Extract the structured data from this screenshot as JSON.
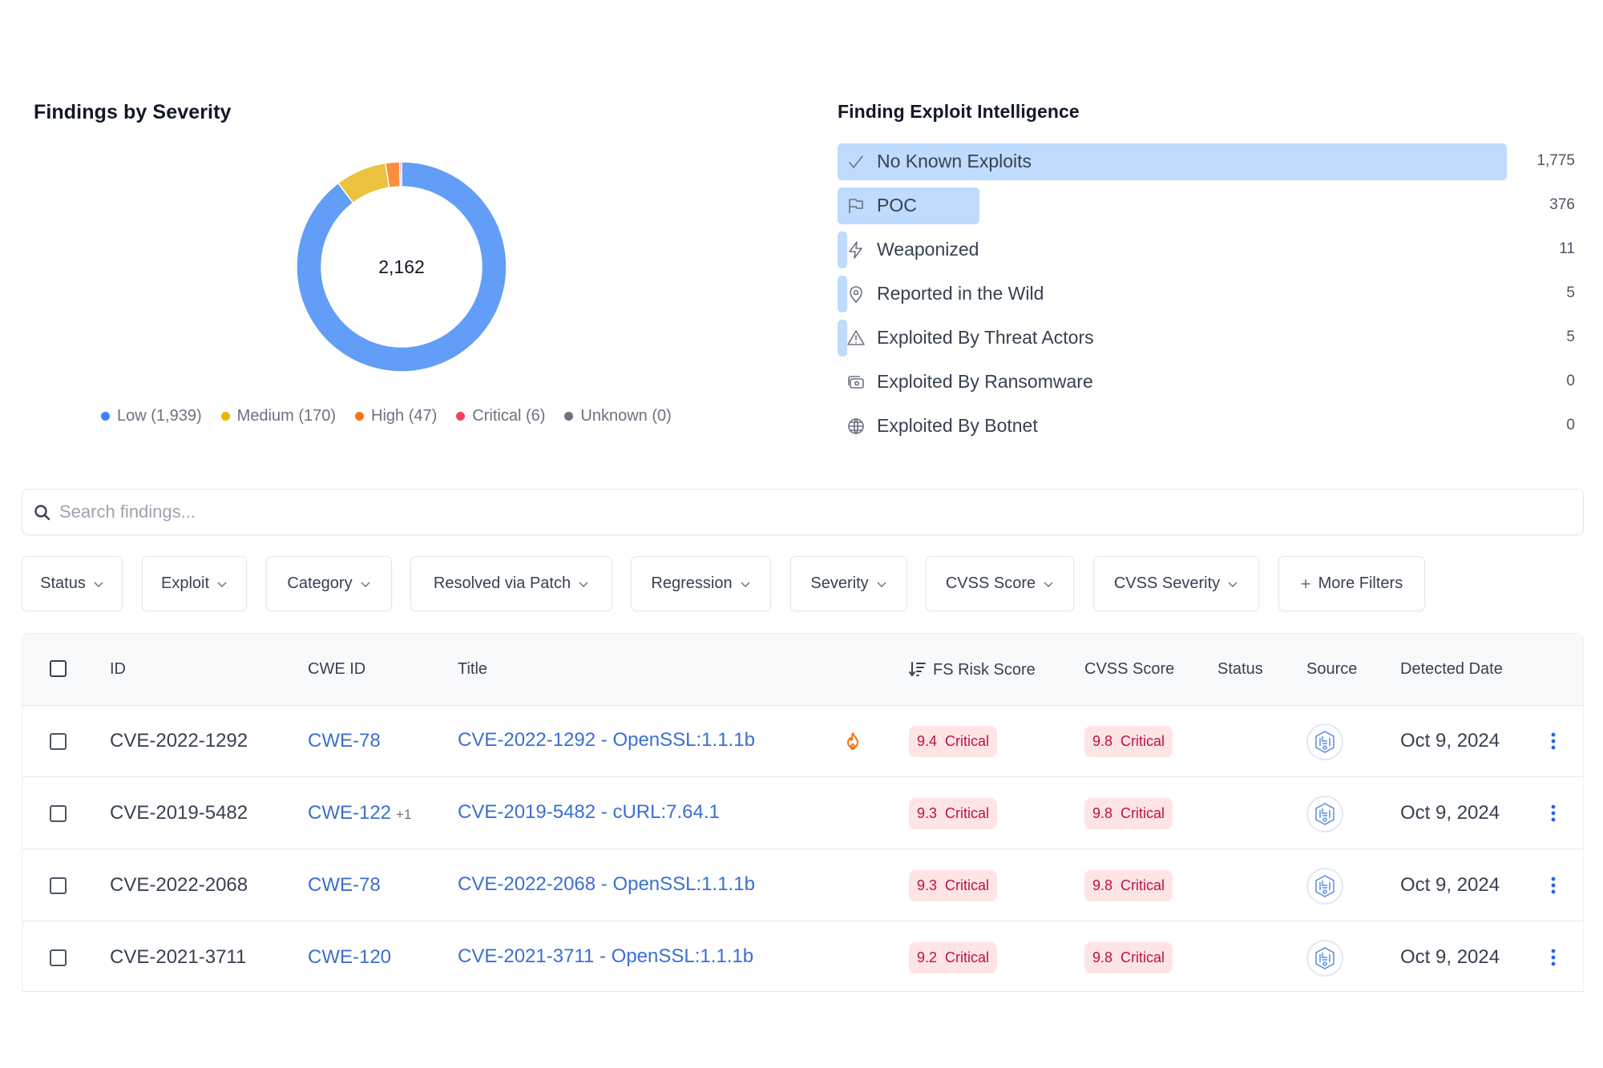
{
  "severity_panel": {
    "title": "Findings by Severity",
    "total": "2,162",
    "legend": [
      {
        "label": "Low (1,939)",
        "color": "#3b82f6"
      },
      {
        "label": "Medium (170)",
        "color": "#eab308"
      },
      {
        "label": "High (47)",
        "color": "#f97316"
      },
      {
        "label": "Critical (6)",
        "color": "#f43f5e"
      },
      {
        "label": "Unknown (0)",
        "color": "#6b7280"
      }
    ]
  },
  "chart_data": {
    "type": "pie",
    "title": "Findings by Severity",
    "center_label": "2,162",
    "categories": [
      "Low",
      "Medium",
      "High",
      "Critical",
      "Unknown"
    ],
    "values": [
      1939,
      170,
      47,
      6,
      0
    ],
    "colors": [
      "#629ef8",
      "#ecc23e",
      "#f98d40",
      "#f2576e",
      "#6b7280"
    ],
    "legend_position": "bottom"
  },
  "exploit_panel": {
    "title": "Finding Exploit Intelligence",
    "max": 1775,
    "items": [
      {
        "label": "No Known Exploits",
        "value": 1775,
        "display": "1,775",
        "icon": "check-icon"
      },
      {
        "label": "POC",
        "value": 376,
        "display": "376",
        "icon": "flag-icon"
      },
      {
        "label": "Weaponized",
        "value": 11,
        "display": "11",
        "icon": "lightning-icon"
      },
      {
        "label": "Reported in the Wild",
        "value": 5,
        "display": "5",
        "icon": "map-pin-icon"
      },
      {
        "label": "Exploited By Threat Actors",
        "value": 5,
        "display": "5",
        "icon": "warning-triangle-icon"
      },
      {
        "label": "Exploited By Ransomware",
        "value": 0,
        "display": "0",
        "icon": "ransomware-icon"
      },
      {
        "label": "Exploited By Botnet",
        "value": 0,
        "display": "0",
        "icon": "globe-icon"
      }
    ]
  },
  "search": {
    "placeholder": "Search findings...",
    "value": ""
  },
  "filters": [
    {
      "label": "Status",
      "dropdown": true
    },
    {
      "label": "Exploit",
      "dropdown": true
    },
    {
      "label": "Category",
      "dropdown": true
    },
    {
      "label": "Resolved via Patch",
      "dropdown": true
    },
    {
      "label": "Regression",
      "dropdown": true
    },
    {
      "label": "Severity",
      "dropdown": true
    },
    {
      "label": "CVSS Score",
      "dropdown": true
    },
    {
      "label": "CVSS Severity",
      "dropdown": true
    },
    {
      "label": "More Filters",
      "dropdown": false,
      "prefix": "+"
    }
  ],
  "table": {
    "columns": {
      "id": "ID",
      "cwe": "CWE ID",
      "title": "Title",
      "fs_risk": "FS Risk Score",
      "cvss": "CVSS Score",
      "status": "Status",
      "source": "Source",
      "date": "Detected Date"
    },
    "sort_column": "FS Risk Score",
    "rows": [
      {
        "id": "CVE-2022-1292",
        "cwe": "CWE-78",
        "cwe_extra": "",
        "title": "CVE-2022-1292 - OpenSSL:1.1.1b",
        "hot": true,
        "fs_score": "9.4",
        "fs_severity": "Critical",
        "cvss_score": "9.8",
        "cvss_severity": "Critical",
        "status": "",
        "source_icon": "scanner-logo-icon",
        "date": "Oct 9, 2024"
      },
      {
        "id": "CVE-2019-5482",
        "cwe": "CWE-122",
        "cwe_extra": "+1",
        "title": "CVE-2019-5482 - cURL:7.64.1",
        "hot": false,
        "fs_score": "9.3",
        "fs_severity": "Critical",
        "cvss_score": "9.8",
        "cvss_severity": "Critical",
        "status": "",
        "source_icon": "scanner-logo-icon",
        "date": "Oct 9, 2024"
      },
      {
        "id": "CVE-2022-2068",
        "cwe": "CWE-78",
        "cwe_extra": "",
        "title": "CVE-2022-2068 - OpenSSL:1.1.1b",
        "hot": false,
        "fs_score": "9.3",
        "fs_severity": "Critical",
        "cvss_score": "9.8",
        "cvss_severity": "Critical",
        "status": "",
        "source_icon": "scanner-logo-icon",
        "date": "Oct 9, 2024"
      },
      {
        "id": "CVE-2021-3711",
        "cwe": "CWE-120",
        "cwe_extra": "",
        "title": "CVE-2021-3711 - OpenSSL:1.1.1b",
        "hot": false,
        "fs_score": "9.2",
        "fs_severity": "Critical",
        "cvss_score": "9.8",
        "cvss_severity": "Critical",
        "status": "",
        "source_icon": "scanner-logo-icon",
        "date": "Oct 9, 2024"
      }
    ]
  }
}
